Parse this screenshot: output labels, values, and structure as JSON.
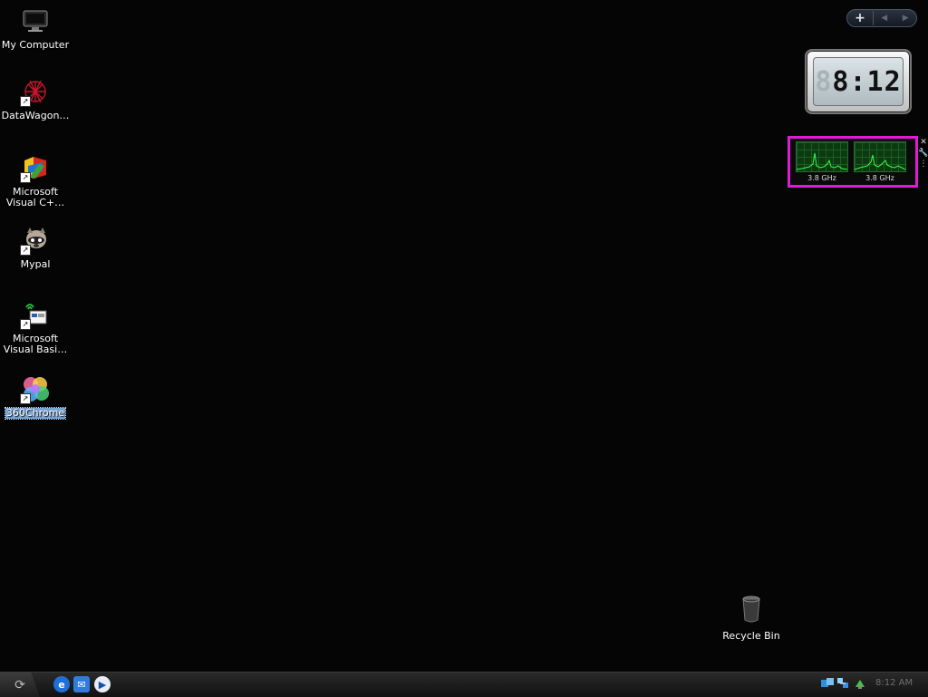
{
  "desktop_icons": [
    {
      "name": "My Computer"
    },
    {
      "name": "DataWagon…"
    },
    {
      "name": "Microsoft Visual C+…"
    },
    {
      "name": "Mypal"
    },
    {
      "name": "Microsoft Visual Basi…"
    },
    {
      "name": "360Chrome"
    }
  ],
  "recycle_bin": {
    "label": "Recycle Bin"
  },
  "sidebar_controls": {
    "add": "+",
    "prev": "◀",
    "next": "▶"
  },
  "clock_gadget": {
    "ghost_digit": "8",
    "time": "8:12"
  },
  "cpu_meter": {
    "cores": [
      {
        "speed": "3.8 GHz"
      },
      {
        "speed": "3.8 GHz"
      }
    ],
    "close": "✕",
    "options": "🔧",
    "drag": "⋮"
  },
  "taskbar": {
    "start_glyph": "⟳",
    "quick_launch": [
      {
        "name": "internet-explorer",
        "glyph": "e"
      },
      {
        "name": "outlook-express",
        "glyph": "✉"
      },
      {
        "name": "media-player",
        "glyph": "▶"
      }
    ],
    "clock": "8:12 AM"
  }
}
